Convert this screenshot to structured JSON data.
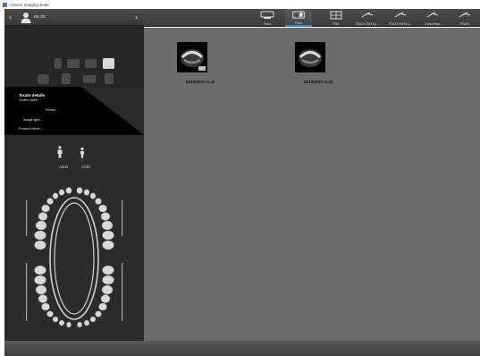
{
  "window": {
    "title": "Acteon Imaging Suite"
  },
  "patient": {
    "name": "es ds",
    "prev": "‹",
    "next": "›"
  },
  "exam_details": {
    "heading": "Exam details",
    "subheading": "Exam name:",
    "fields": [
      {
        "label": "Kernel –"
      },
      {
        "label": "Image type –"
      },
      {
        "label": "Product name –"
      }
    ]
  },
  "age_selector": {
    "adult_label": "Adult",
    "child_label": "Child"
  },
  "toolbar": {
    "buttons": [
      {
        "label": "Pano",
        "icon": "panoramic-icon",
        "active": false
      },
      {
        "label": "Pano",
        "icon": "pano-scan-icon",
        "active": true
      },
      {
        "label": "FMX",
        "icon": "fmx-icon",
        "active": false
      },
      {
        "label": "TRAXX FMTX p…",
        "icon": "sensor-icon",
        "active": false
      },
      {
        "label": "TRAXX FMTX p…",
        "icon": "sensor-icon",
        "active": false
      },
      {
        "label": "4 Wird Pano",
        "icon": "sensor-icon",
        "active": false
      },
      {
        "label": "TRAXX",
        "icon": "sensor-icon",
        "active": false
      }
    ]
  },
  "thumbnails": [
    {
      "date": "02/10/2019 11:42"
    },
    {
      "date": "02/10/2019 11:42"
    }
  ],
  "colors": {
    "accent": "#2e8bd8",
    "panel": "#2b2b2b",
    "main": "#6b6b6b",
    "exam_bg": "#000000"
  }
}
